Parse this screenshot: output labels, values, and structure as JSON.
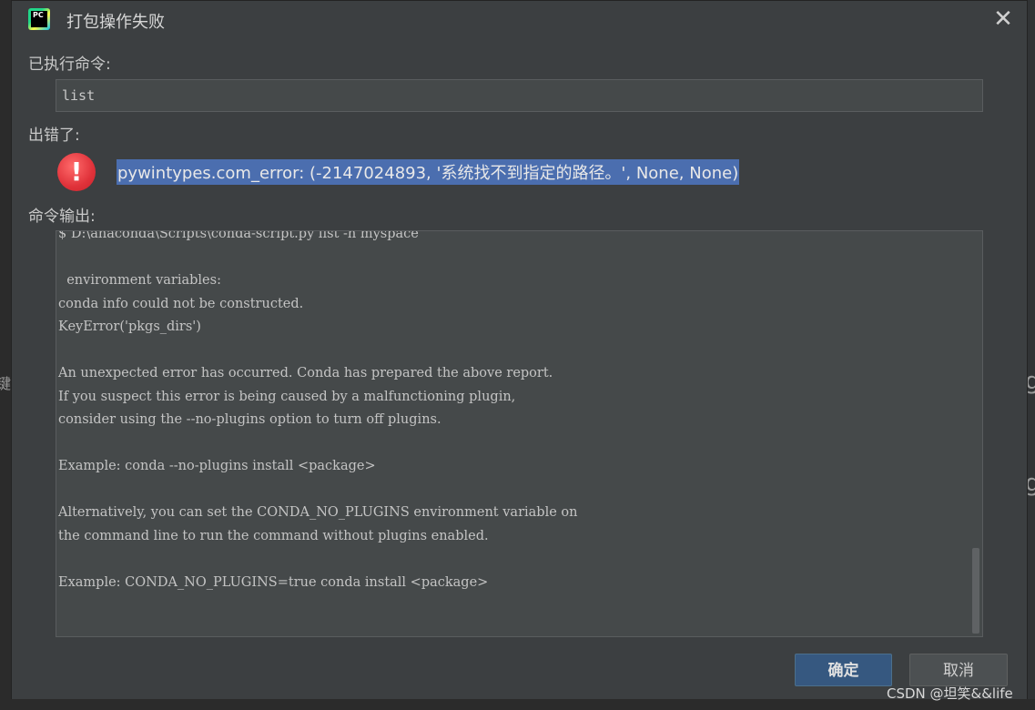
{
  "dialog": {
    "title": "打包操作失败",
    "close_symbol": "✕",
    "app_icon_text": "PC"
  },
  "command_section": {
    "label": "已执行命令:",
    "value": "list"
  },
  "error_section": {
    "label": "出错了:",
    "icon_symbol": "!",
    "message": "pywintypes.com_error: (-2147024893, '系统找不到指定的路径。', None, None)"
  },
  "output_section": {
    "label": "命令输出:",
    "lines": [
      "$ D:\\anaconda\\Scripts\\conda-script.py list -n myspace",
      "",
      "  environment variables:",
      "conda info could not be constructed.",
      "KeyError('pkgs_dirs')",
      "",
      "An unexpected error has occurred. Conda has prepared the above report.",
      "If you suspect this error is being caused by a malfunctioning plugin,",
      "consider using the --no-plugins option to turn off plugins.",
      "",
      "Example: conda --no-plugins install <package>",
      "",
      "Alternatively, you can set the CONDA_NO_PLUGINS environment variable on",
      "the command line to run the command without plugins enabled.",
      "",
      "Example: CONDA_NO_PLUGINS=true conda install <package>"
    ]
  },
  "buttons": {
    "ok": "确定",
    "cancel": "取消"
  },
  "background": {
    "left_glyph": "键",
    "right_glyph_1": "g",
    "right_glyph_2": "g"
  },
  "watermark": "CSDN @坦笑&&life",
  "colors": {
    "dialog_bg": "#3c3f41",
    "field_bg": "#45494a",
    "selection": "#4b6eaf",
    "primary_button": "#365880",
    "error_red": "#e0323a"
  }
}
